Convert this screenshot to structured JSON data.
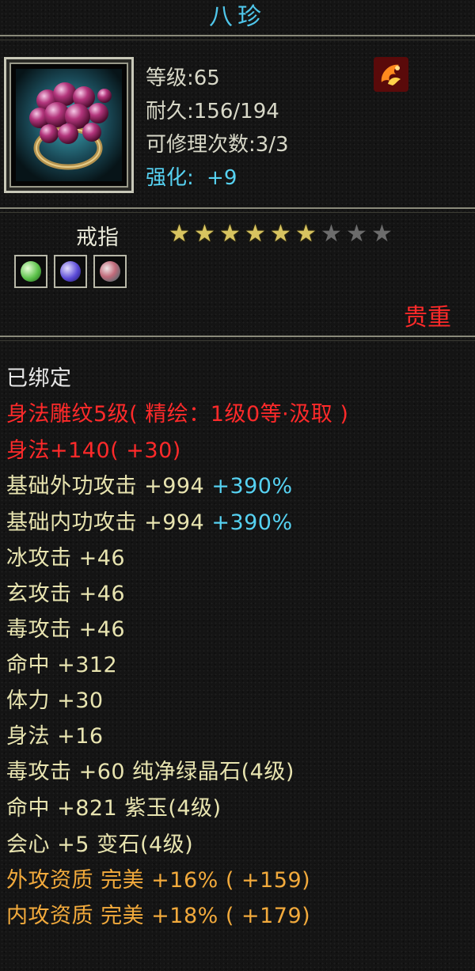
{
  "item": {
    "name": "八珍",
    "level_text": "等级:65",
    "durability_text": "耐久:156/194",
    "repair_text": "可修理次数:3/3",
    "enhance_label": "强化:",
    "enhance_value": "+9",
    "type": "戒指",
    "stars_total": 9,
    "stars_filled": 6,
    "rarity": "贵重",
    "bind_status": "已绑定"
  },
  "icons": {
    "item_icon": "ring-icon",
    "bind_badge": "fire-bird-icon",
    "gem_slots": [
      "green-gem-icon",
      "purple-gem-icon",
      "teal-gem-icon"
    ]
  },
  "attributes": [
    {
      "text": "身法雕纹5级( 精绘：1级0等·汲取 )",
      "color": "red"
    },
    {
      "text": "身法+140( +30)",
      "color": "red"
    },
    {
      "text": "基础外功攻击  +994",
      "extra": " +390%",
      "color": "yellow"
    },
    {
      "text": "基础内功攻击  +994",
      "extra": " +390%",
      "color": "yellow"
    },
    {
      "text": "冰攻击  +46",
      "color": "yellow"
    },
    {
      "text": "玄攻击  +46",
      "color": "yellow"
    },
    {
      "text": "毒攻击  +46",
      "color": "yellow"
    },
    {
      "text": "命中  +312",
      "color": "yellow"
    },
    {
      "text": "体力  +30",
      "color": "yellow"
    },
    {
      "text": "身法  +16",
      "color": "yellow"
    },
    {
      "text": "毒攻击  +60  纯净绿晶石(4级)",
      "color": "yellow"
    },
    {
      "text": "命中  +821  紫玉(4级)",
      "color": "yellow"
    },
    {
      "text": "会心  +5  变石(4级)",
      "color": "yellow"
    },
    {
      "text": "外攻资质    完美  +16% ( +159)",
      "color": "orange"
    },
    {
      "text": "内攻资质    完美  +18% ( +179)",
      "color": "orange"
    }
  ],
  "colors": {
    "title": "#4fc6ea",
    "red": "#ff2a2a",
    "yellow": "#e8e4b0",
    "cyan": "#56d2f2",
    "orange": "#f2aa3c",
    "star_on": "#d8c460",
    "star_off": "#6c6c6c"
  }
}
